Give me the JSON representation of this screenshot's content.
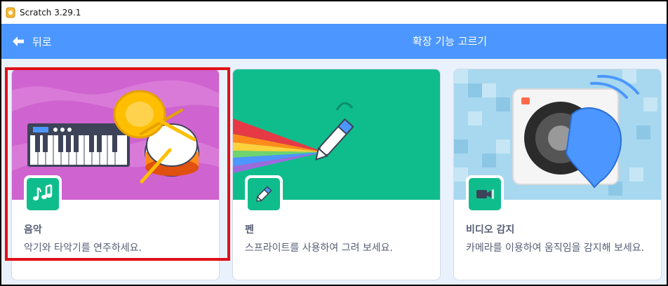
{
  "window": {
    "title": "Scratch 3.29.1"
  },
  "menubar": {
    "back_label": "뒤로",
    "title": "확장 기능 고르기",
    "color": "#4c97ff"
  },
  "extensions": [
    {
      "title": "음악",
      "description": "악기와 타악기를 연주하세요.",
      "icon": "music-notes-icon",
      "accent": "#cf63cf"
    },
    {
      "title": "펜",
      "description": "스프라이트를 사용하여 그려 보세요.",
      "icon": "pen-icon",
      "accent": "#0fbd8c"
    },
    {
      "title": "비디오 감지",
      "description": "카메라를 이용하여 움직임을 감지해 보세요.",
      "icon": "video-camera-icon",
      "accent": "#a8d8ef"
    }
  ],
  "highlight": {
    "color": "#e0101a",
    "target": "음악"
  }
}
